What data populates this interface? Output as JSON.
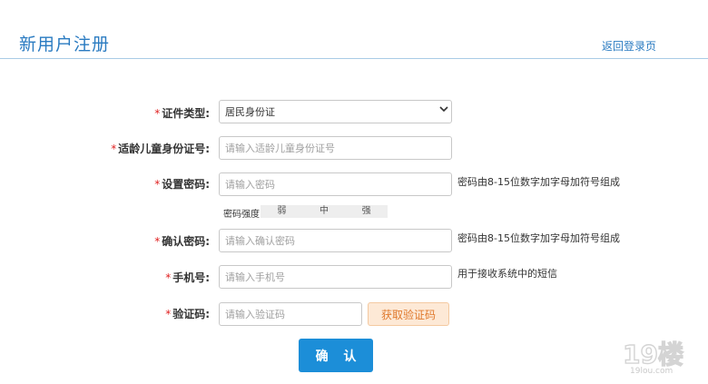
{
  "header": {
    "title": "新用户注册",
    "back_link": "返回登录页"
  },
  "form": {
    "required_mark": "*",
    "id_type": {
      "label": "证件类型:",
      "selected": "居民身份证"
    },
    "child_id": {
      "label": "适龄儿童身份证号:",
      "placeholder": "请输入适龄儿童身份证号"
    },
    "password": {
      "label": "设置密码:",
      "placeholder": "请输入密码",
      "hint": "密码由8-15位数字加字母加符号组成"
    },
    "strength": {
      "label": "密码强度",
      "levels": [
        "弱",
        "中",
        "强"
      ]
    },
    "confirm_password": {
      "label": "确认密码:",
      "placeholder": "请输入确认密码",
      "hint": "密码由8-15位数字加字母加符号组成"
    },
    "phone": {
      "label": "手机号:",
      "placeholder": "请输入手机号",
      "hint": "用于接收系统中的短信"
    },
    "code": {
      "label": "验证码:",
      "placeholder": "请输入验证码",
      "button": "获取验证码"
    },
    "submit_label": "确 认"
  },
  "watermark": {
    "logo": "19楼",
    "site": "19lou.com"
  },
  "colors": {
    "accent": "#2a7bc1",
    "primary_button": "#1c8ed8",
    "required": "#e02020",
    "code_button_bg": "#fde9d6",
    "code_button_text": "#e0792d"
  }
}
